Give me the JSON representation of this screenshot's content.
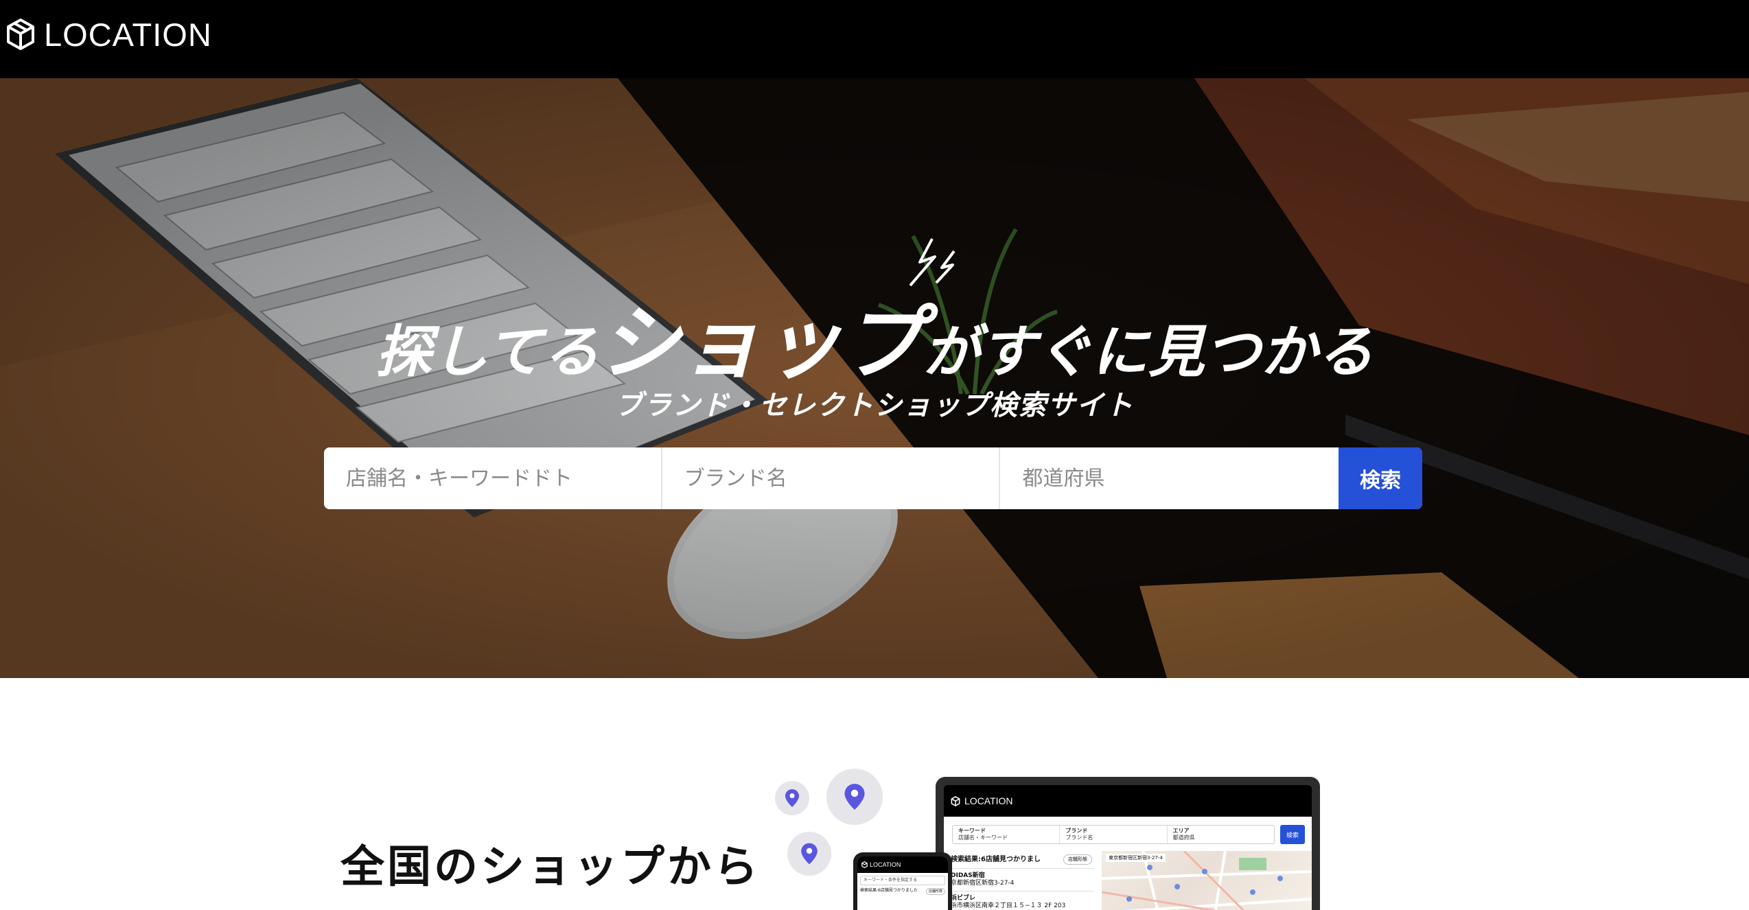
{
  "header": {
    "logo_text": "LOCATION",
    "logo_icon": "cube-icon"
  },
  "hero": {
    "headline_part1": "探してる",
    "headline_emphasis": "ショップ",
    "headline_part2": "がすぐに見つかる",
    "subheadline": "ブランド・セレクトショップ検索サイト",
    "search": {
      "keyword_placeholder": "店舗名・キーワードドト",
      "brand_placeholder": "ブランド名",
      "area_placeholder": "都道府県",
      "button_label": "検索"
    }
  },
  "section": {
    "title": "全国のショップから"
  },
  "mockup": {
    "tablet": {
      "logo_text": "LOCATION",
      "search_keyword_label": "キーワード",
      "search_keyword_hint": "店舗名・キーワード",
      "search_brand_label": "ブランド",
      "search_brand_hint": "ブランド名",
      "search_area_label": "エリア",
      "search_area_hint": "都道府県",
      "search_button": "検索",
      "results_heading": "検索結果:6店舗見つかりまし",
      "sort_label": "店舗形態",
      "result_1_name": "DIDAS新宿",
      "result_1_address": "京都新宿区新宿3-27-4",
      "result_2_name": "浜ビブレ",
      "result_2_address": "浜市横浜区南幸２丁目１５−１３ 2F 203",
      "map_address": "東京都新宿区新宿3-27-4"
    },
    "phone": {
      "logo_text": "LOCATION",
      "search_hint": "キーワード・条件を指定する",
      "results_text": "検索結果:6店舗見つかりました",
      "sort_label": "店舗形態"
    }
  },
  "colors": {
    "header_bg": "#000000",
    "accent": "#2550d8",
    "pin": "#5a56e0",
    "pin_bg": "#e6e6ea"
  }
}
